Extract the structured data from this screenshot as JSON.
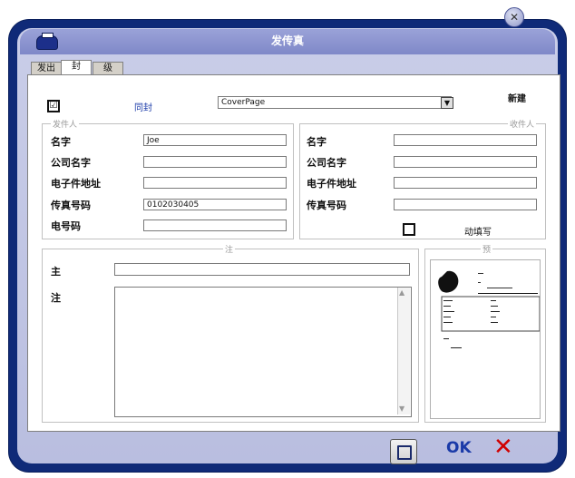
{
  "window": {
    "title": "发传真"
  },
  "tabs": [
    {
      "label": "发出"
    },
    {
      "label": "封"
    },
    {
      "label": "级"
    }
  ],
  "cover": {
    "checkbox_mark": "☑",
    "link": "同封",
    "template": "CoverPage",
    "new_label": "新建"
  },
  "sender": {
    "legend": "发件人",
    "fields": [
      {
        "label": "名字",
        "value": "Joe"
      },
      {
        "label": "公司名字",
        "value": ""
      },
      {
        "label": "电子件地址",
        "value": ""
      },
      {
        "label": "传真号码",
        "value": "0102030405"
      },
      {
        "label": "电号码",
        "value": ""
      }
    ]
  },
  "recipient": {
    "legend": "收件人",
    "fields": [
      {
        "label": "名字",
        "value": ""
      },
      {
        "label": "公司名字",
        "value": ""
      },
      {
        "label": "电子件地址",
        "value": ""
      },
      {
        "label": "传真号码",
        "value": ""
      }
    ],
    "autofill_label": "动填写"
  },
  "note": {
    "legend": "注",
    "subject_label": "主",
    "subject_value": "",
    "note_label": "注"
  },
  "preview": {
    "legend": "预"
  },
  "buttons": {
    "ok_label": "OK",
    "cancel_glyph": "✕"
  }
}
